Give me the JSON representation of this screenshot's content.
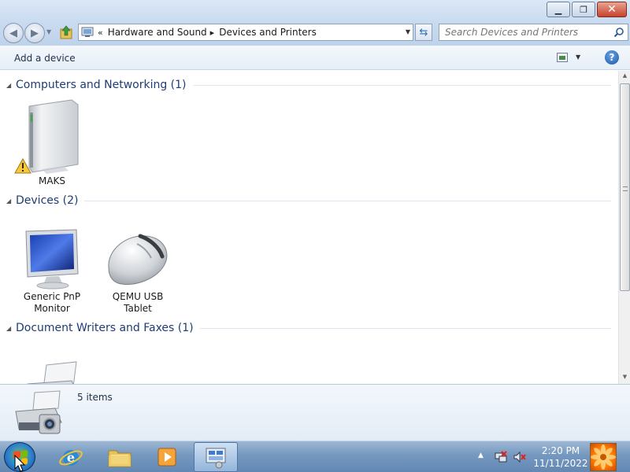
{
  "window": {
    "controls": {
      "minimize": "▁",
      "restore": "❐",
      "close": "✕"
    }
  },
  "nav": {
    "back_icon": "back-arrow-icon",
    "forward_icon": "forward-arrow-icon",
    "chevron_start": "«",
    "breadcrumbs": [
      "Hardware and Sound",
      "Devices and Printers"
    ],
    "search_placeholder": "Search Devices and Printers"
  },
  "toolbar": {
    "add_device_label": "Add a device",
    "help_glyph": "?"
  },
  "groups": [
    {
      "title": "Computers and Networking (1)",
      "devices": [
        {
          "label": "MAKS",
          "icon": "computer-warning-icon"
        }
      ]
    },
    {
      "title": "Devices (2)",
      "devices": [
        {
          "label": "Generic PnP Monitor",
          "icon": "monitor-icon"
        },
        {
          "label": "QEMU USB Tablet",
          "icon": "mouse-icon"
        }
      ]
    },
    {
      "title": "Document Writers and Faxes (1)",
      "devices": [
        {
          "label": "",
          "icon": "fax-printer-icon"
        }
      ]
    }
  ],
  "details": {
    "item_count": "5 items"
  },
  "taskbar": {
    "clock_time": "2:20 PM",
    "clock_date": "11/11/2022"
  },
  "colors": {
    "group_header": "#1e3d73",
    "taskbar": "#6288b3",
    "titlebar": "#c9dbf0"
  }
}
